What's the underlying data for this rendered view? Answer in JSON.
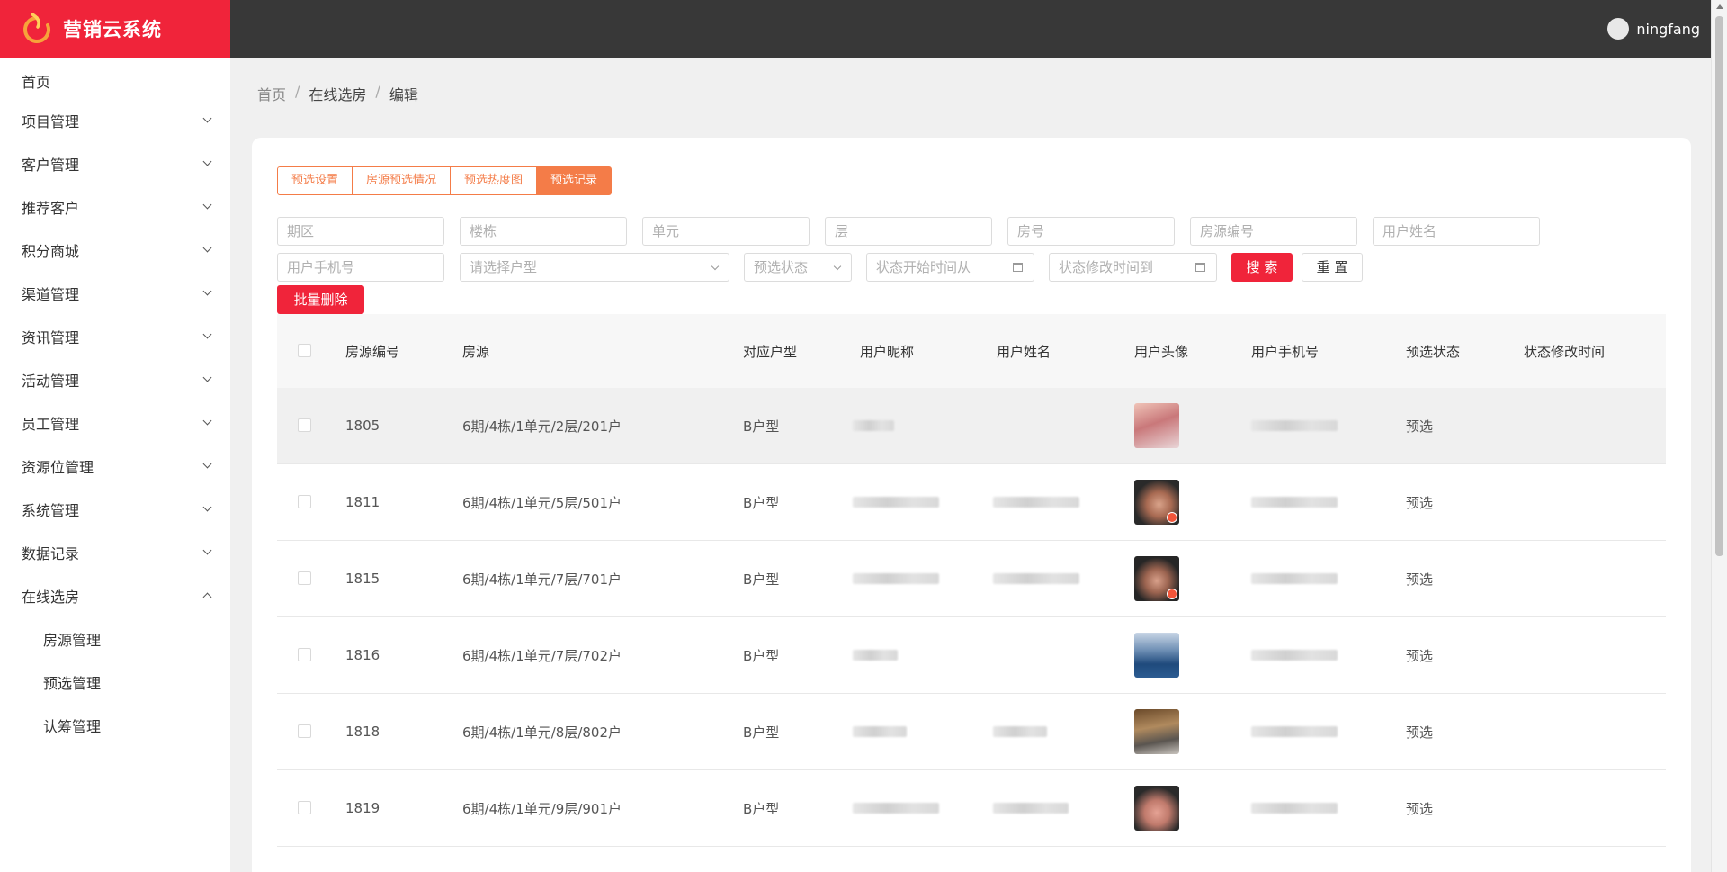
{
  "app": {
    "title": "营销云系统"
  },
  "user": {
    "name": "ningfang"
  },
  "sidebar": {
    "items": [
      {
        "label": "首页",
        "expandable": false
      },
      {
        "label": "项目管理",
        "expandable": true
      },
      {
        "label": "客户管理",
        "expandable": true
      },
      {
        "label": "推荐客户",
        "expandable": true
      },
      {
        "label": "积分商城",
        "expandable": true
      },
      {
        "label": "渠道管理",
        "expandable": true
      },
      {
        "label": "资讯管理",
        "expandable": true
      },
      {
        "label": "活动管理",
        "expandable": true
      },
      {
        "label": "员工管理",
        "expandable": true
      },
      {
        "label": "资源位管理",
        "expandable": true
      },
      {
        "label": "系统管理",
        "expandable": true
      },
      {
        "label": "数据记录",
        "expandable": true
      },
      {
        "label": "在线选房",
        "expandable": true,
        "expanded": true
      }
    ],
    "subitems": [
      {
        "label": "房源管理"
      },
      {
        "label": "预选管理"
      },
      {
        "label": "认筹管理"
      }
    ]
  },
  "breadcrumb": {
    "home": "首页",
    "section": "在线选房",
    "current": "编辑",
    "sep": "/"
  },
  "tabs": [
    {
      "label": "预选设置"
    },
    {
      "label": "房源预选情况"
    },
    {
      "label": "预选热度图"
    },
    {
      "label": "预选记录",
      "active": true
    }
  ],
  "filters": {
    "phase": "期区",
    "building": "楼栋",
    "unit": "单元",
    "floor": "层",
    "room": "房号",
    "house_code": "房源编号",
    "user_name": "用户姓名",
    "phone": "用户手机号",
    "house_type": "请选择户型",
    "status": "预选状态",
    "start_time": "状态开始时间从",
    "end_time": "状态修改时间到"
  },
  "buttons": {
    "search": "搜 索",
    "reset": "重 置",
    "batch_delete": "批量删除"
  },
  "table": {
    "columns": [
      "房源编号",
      "房源",
      "对应户型",
      "用户昵称",
      "用户姓名",
      "用户头像",
      "用户手机号",
      "预选状态",
      "状态修改时间"
    ],
    "rows": [
      {
        "code": "1805",
        "house": "6期/4栋/1单元/2层/201户",
        "type": "B户型",
        "status": "预选"
      },
      {
        "code": "1811",
        "house": "6期/4栋/1单元/5层/501户",
        "type": "B户型",
        "status": "预选"
      },
      {
        "code": "1815",
        "house": "6期/4栋/1单元/7层/701户",
        "type": "B户型",
        "status": "预选"
      },
      {
        "code": "1816",
        "house": "6期/4栋/1单元/7层/702户",
        "type": "B户型",
        "status": "预选"
      },
      {
        "code": "1818",
        "house": "6期/4栋/1单元/8层/802户",
        "type": "B户型",
        "status": "预选"
      },
      {
        "code": "1819",
        "house": "6期/4栋/1单元/9层/901户",
        "type": "B户型",
        "status": "预选"
      }
    ]
  },
  "colors": {
    "brand": "#f0243a",
    "accent": "#f47c48",
    "topbar": "#383838"
  }
}
